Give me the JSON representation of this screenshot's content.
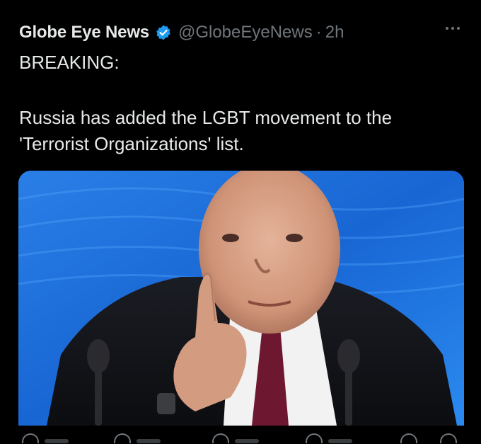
{
  "tweet": {
    "author_name": "Globe Eye News",
    "handle": "@GlobeEyeNews",
    "separator": "·",
    "time": "2h",
    "verified_icon": "verified-badge-icon",
    "line1": "BREAKING:",
    "line2": "Russia has added the LGBT movement to the",
    "line3": "'Terrorist Organizations' list."
  },
  "media": {
    "kind": "photo",
    "background_color": "#1a6fd8"
  },
  "actions": [
    {
      "name": "reply-icon"
    },
    {
      "name": "retweet-icon"
    },
    {
      "name": "like-icon"
    },
    {
      "name": "views-icon"
    },
    {
      "name": "bookmark-icon"
    },
    {
      "name": "share-icon"
    }
  ],
  "colors": {
    "background": "#000000",
    "text": "#e7e9ea",
    "secondary": "#71767b",
    "verified": "#1d9bf0"
  }
}
